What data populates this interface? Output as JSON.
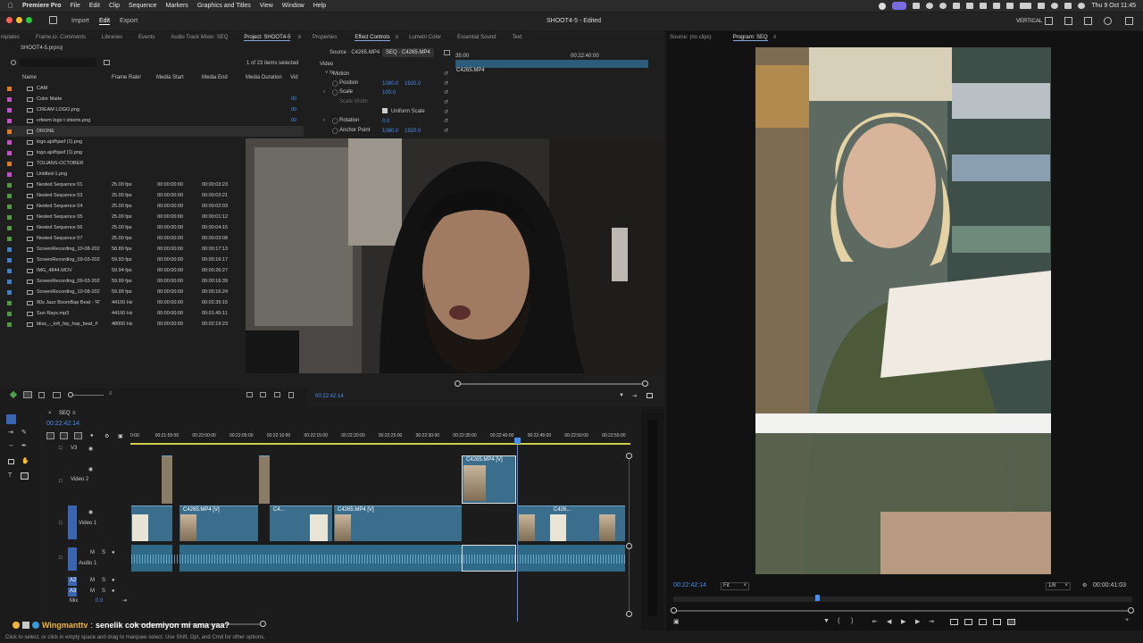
{
  "menubar": {
    "app": "Premiere Pro",
    "items": [
      "File",
      "Edit",
      "Clip",
      "Sequence",
      "Markers",
      "Graphics and Titles",
      "View",
      "Window",
      "Help"
    ],
    "datetime": "Thu 9 Oct  11:45"
  },
  "header": {
    "nav": [
      "Import",
      "Edit",
      "Export"
    ],
    "active_nav": "Edit",
    "title": "SHOOT4-5 - Edited",
    "vertical_label": "VERTICAL"
  },
  "project_panel": {
    "tabs": [
      "mplates",
      "Frame.io: Comments",
      "Libraries",
      "Events",
      "Audio Track Mixer: SEQ",
      "Project: SHOOT4-5"
    ],
    "active_tab": "Project: SHOOT4-5",
    "file": "SHOOT4-5.prproj",
    "selection_info": "1 of 23 items selected",
    "columns": [
      "Name",
      "Frame Rate",
      "Media Start",
      "Media End",
      "Media Duration",
      "Vid"
    ],
    "rows": [
      {
        "name": "CAM",
        "rate": "",
        "start": "",
        "end": "",
        "dur": "",
        "color": "#e07b24",
        "type": "folder"
      },
      {
        "name": "Color Matte",
        "rate": "",
        "start": "",
        "end": "",
        "dur": "00",
        "color": "#c74fc7",
        "type": "item"
      },
      {
        "name": "CREAM LOGO.png",
        "rate": "",
        "start": "",
        "end": "",
        "dur": "00",
        "color": "#c74fc7",
        "type": "item"
      },
      {
        "name": "crfeem logo t shierts.png",
        "rate": "",
        "start": "",
        "end": "",
        "dur": "00",
        "color": "#c74fc7",
        "type": "item"
      },
      {
        "name": "DRONE",
        "rate": "",
        "start": "",
        "end": "",
        "dur": "",
        "color": "#e07b24",
        "type": "folder"
      },
      {
        "name": "logo.ajsfhjasf (1).png",
        "rate": "",
        "start": "",
        "end": "",
        "dur": "",
        "color": "#c74fc7",
        "type": "item"
      },
      {
        "name": "logo.ajsfhjasf (1).png",
        "rate": "",
        "start": "",
        "end": "",
        "dur": "",
        "color": "#c74fc7",
        "type": "item"
      },
      {
        "name": "TOLIANS-OCTOBER",
        "rate": "",
        "start": "",
        "end": "",
        "dur": "",
        "color": "#e07b24",
        "type": "folder"
      },
      {
        "name": "Untitled-1.png",
        "rate": "",
        "start": "",
        "end": "",
        "dur": "",
        "color": "#c74fc7",
        "type": "item"
      },
      {
        "name": "Nested Sequence 01",
        "rate": "25.00 fps",
        "start": "00:00:00:00",
        "end": "00:00:03:23",
        "dur": "",
        "color": "#4e9a3c",
        "type": "item"
      },
      {
        "name": "Nested Sequence 03",
        "rate": "25.00 fps",
        "start": "00:00:00:00",
        "end": "00:00:03:21",
        "dur": "",
        "color": "#4e9a3c",
        "type": "item"
      },
      {
        "name": "Nested Sequence 04",
        "rate": "25.00 fps",
        "start": "00:00:00:00",
        "end": "00:00:02:03",
        "dur": "",
        "color": "#4e9a3c",
        "type": "item"
      },
      {
        "name": "Nested Sequence 05",
        "rate": "25.00 fps",
        "start": "00:00:00:00",
        "end": "00:00:01:12",
        "dur": "",
        "color": "#4e9a3c",
        "type": "item"
      },
      {
        "name": "Nested Sequence 06",
        "rate": "25.00 fps",
        "start": "00:00:00:00",
        "end": "00:00:04:15",
        "dur": "",
        "color": "#4e9a3c",
        "type": "item"
      },
      {
        "name": "Nested Sequence 07",
        "rate": "25.00 fps",
        "start": "00:00:00:00",
        "end": "00:00:03:08",
        "dur": "",
        "color": "#4e9a3c",
        "type": "item"
      },
      {
        "name": "ScreenRecording_10-08-202",
        "rate": "58.89 fps",
        "start": "00:00:00:00",
        "end": "00:00:17:13",
        "dur": "",
        "color": "#3f7fc9",
        "type": "item"
      },
      {
        "name": "ScreenRecording_09-03-202",
        "rate": "59.93 fps",
        "start": "00:00:00:00",
        "end": "00:00:16:17",
        "dur": "",
        "color": "#3f7fc9",
        "type": "item"
      },
      {
        "name": "IMG_4844.MOV",
        "rate": "59.94 fps",
        "start": "00:00:00:00",
        "end": "00:00:26:27",
        "dur": "",
        "color": "#3f7fc9",
        "type": "item"
      },
      {
        "name": "ScreenRecording_09-03-202",
        "rate": "59.99 fps",
        "start": "00:00:00:00",
        "end": "00:00:16:39",
        "dur": "",
        "color": "#3f7fc9",
        "type": "item"
      },
      {
        "name": "ScreenRecording_10-08-202",
        "rate": "59.99 fps",
        "start": "00:00:00:00",
        "end": "00:00:16:24",
        "dur": "",
        "color": "#3f7fc9",
        "type": "item"
      },
      {
        "name": "90s Jazz BoomBap Beat - 'R'",
        "rate": "44100 Hz",
        "start": "00:00:00:00",
        "end": "00:02:35:15",
        "dur": "",
        "color": "#4e9a3c",
        "type": "item"
      },
      {
        "name": "Sun Rays.mp3",
        "rate": "44100 Hz",
        "start": "00:00:00:00",
        "end": "00:01:45:11",
        "dur": "",
        "color": "#4e9a3c",
        "type": "item"
      },
      {
        "name": "bliss_-_lofi_hip_hop_beat_F",
        "rate": "48000 Hz",
        "start": "00:00:00:00",
        "end": "00:02:19:23",
        "dur": "",
        "color": "#4e9a3c",
        "type": "item"
      }
    ]
  },
  "effect_controls": {
    "tabs": [
      "Properties",
      "Effect Controls",
      "Lumetri Color",
      "Essential Sound",
      "Text"
    ],
    "active_tab": "Effect Controls",
    "source_tab": "Source · C4265.MP4",
    "seq_tab": "SEQ · C4265.MP4",
    "section": "Video",
    "effect": "Motion",
    "position_label": "Position",
    "position_x": "1080.0",
    "position_y": "1920.0",
    "scale_label": "Scale",
    "scale_value": "100.0",
    "scale_width_label": "Scale Width",
    "uniform_scale": "Uniform Scale",
    "rotation_label": "Rotation",
    "rotation_value": "0.0",
    "anchor_label": "Anchor Point",
    "anchor_x": "1080.0",
    "anchor_y": "1920.0",
    "mini_time_start": "35:00",
    "mini_time_mid": "00:22:40:00",
    "mini_clip": "C4265.MP4",
    "timecode": "00:22:42:14"
  },
  "program_monitor": {
    "source_tab": "Source: (no clips)",
    "program_tab": "Program: SEQ",
    "timecode": "00:22:42:14",
    "fit": "Fit",
    "resolution": "1/8",
    "duration": "00:00:41:03"
  },
  "timeline": {
    "seq_tab": "SEQ",
    "timecode": "00:22:42:14",
    "ruler": [
      "0:00",
      "00:21:55:00",
      "00:22:00:00",
      "00:22:05:00",
      "00:22:10:00",
      "00:22:15:00",
      "00:22:20:00",
      "00:22:25:00",
      "00:22:30:00",
      "00:22:35:00",
      "00:22:40:00",
      "00:22:45:00",
      "00:22:50:00",
      "00:22:55:00"
    ],
    "tracks": {
      "v3": "V3",
      "v2": "Video 2",
      "v1": "Video 1",
      "a1": "Audio 1",
      "a2": "A2",
      "a3": "A3",
      "mix": "Mix",
      "mix_value": "0.0"
    },
    "clip_labels": {
      "v2_clip": "C4265.MP4 [V]",
      "v1_a": "C4265.MP4 [V]",
      "v1_b": "C4...",
      "v1_c": "C4265.MP4 [V]",
      "v1_d": "C426..."
    }
  },
  "chat_overlay": {
    "username": "Wingmanttv",
    "message": "senelik cok odemiyon mi ama yaa?"
  },
  "status_bar": "Click to select, or click in empty space and drag to marquee select. Use Shift, Opt, and Cmd for other options."
}
